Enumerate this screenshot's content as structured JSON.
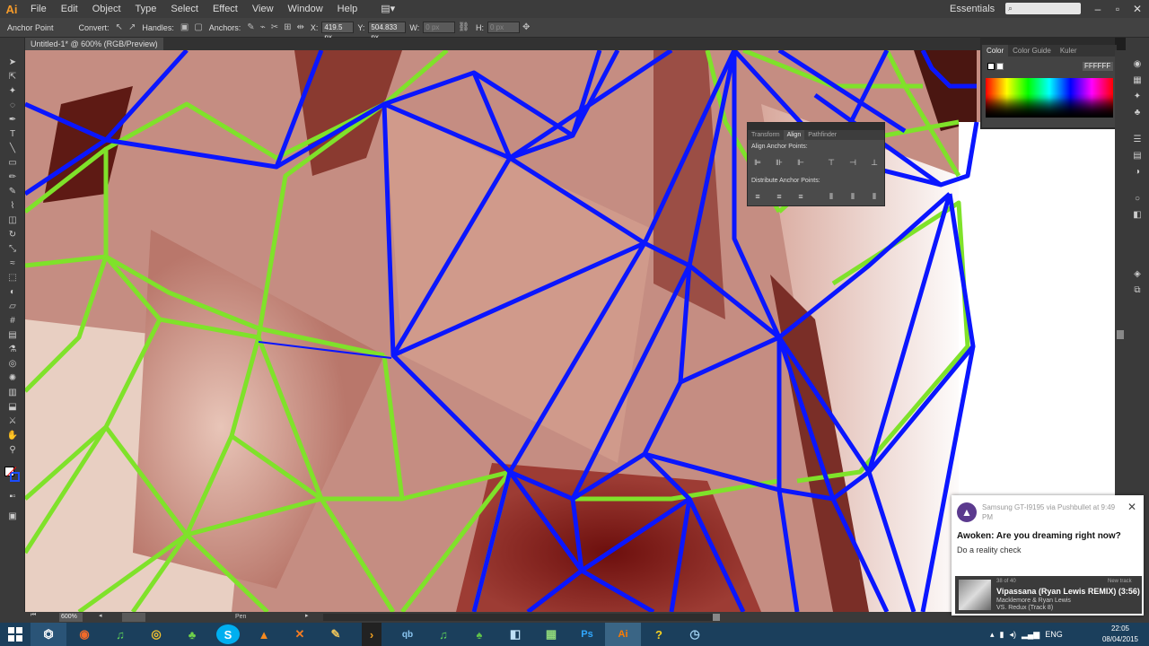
{
  "app": {
    "logo": "Ai"
  },
  "menu": {
    "items": [
      "File",
      "Edit",
      "Object",
      "Type",
      "Select",
      "Effect",
      "View",
      "Window",
      "Help"
    ]
  },
  "workspace": "Essentials",
  "control": {
    "label_anchor": "Anchor Point",
    "label_convert": "Convert:",
    "label_handles": "Handles:",
    "label_anchors": "Anchors:",
    "x_value": "419.5 px",
    "y_value": "504.833 px",
    "w_value": "0 px",
    "h_value": "0 px"
  },
  "document": {
    "tab": "Untitled-1* @ 600% (RGB/Preview)"
  },
  "color_panel": {
    "tabs": [
      "Color",
      "Color Guide",
      "Kuler"
    ],
    "hex": "FFFFFF"
  },
  "align_panel": {
    "tabs": [
      "Transform",
      "Align",
      "Pathfinder"
    ],
    "label_align": "Align Anchor Points:",
    "label_distribute": "Distribute Anchor Points:"
  },
  "status": {
    "zoom": "600%",
    "tool": "Pen"
  },
  "notification": {
    "source": "Samsung GT-I9195 via Pushbullet at 9:49 PM",
    "title": "Awoken: Are you dreaming right now?",
    "body": "Do a reality check",
    "music": {
      "position": "38 of 40",
      "new_track": "New track",
      "song": "Vipassana (Ryan Lewis REMIX) (3:56)",
      "artist": "Macklemore & Ryan Lewis",
      "album": "VS. Redux (Track 8)"
    }
  },
  "taskbar": {
    "lang": "ENG",
    "time": "22:05",
    "date": "08/04/2015",
    "apps": [
      "steam-icon",
      "firefox-icon",
      "spotify-icon",
      "chrome-icon",
      "clover-icon",
      "skype-icon",
      "vlc-icon",
      "xbox-icon",
      "pencil-icon",
      "terminal-icon",
      "qbittorrent-icon",
      "spotify-alt-icon",
      "tree-icon",
      "notepad-icon",
      "image-icon",
      "photoshop-icon",
      "illustrator-icon",
      "help-icon",
      "clock-icon"
    ],
    "app_labels": [
      "⏣",
      "◉",
      "♫",
      "◎",
      "♣",
      "S",
      "▲",
      "✕",
      "✎",
      "›",
      "qb",
      "♫",
      "♠",
      "◧",
      "▦",
      "Ps",
      "Ai",
      "?",
      "◷"
    ]
  },
  "colors": {
    "blue_edge": "#0a16ff",
    "green_edge": "#7fe22a"
  }
}
